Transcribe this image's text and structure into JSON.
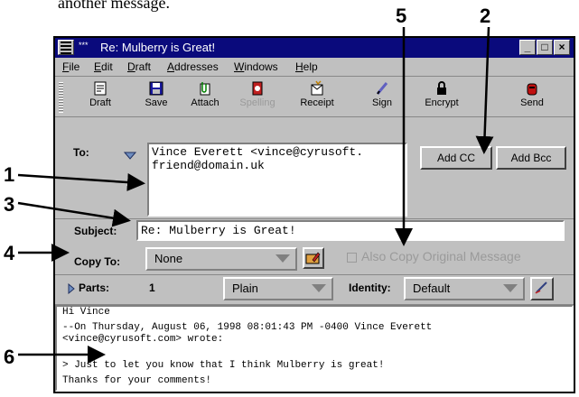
{
  "page": {
    "caption": "another message."
  },
  "window": {
    "title_prefix": "***",
    "title": "Re: Mulberry is Great!",
    "buttons": {
      "minimize": "_",
      "maximize": "□",
      "close": "×"
    }
  },
  "menubar": {
    "items": [
      {
        "label": "File",
        "ul": "F",
        "rest": "ile"
      },
      {
        "label": "Edit",
        "ul": "E",
        "rest": "dit"
      },
      {
        "label": "Draft",
        "ul": "D",
        "rest": "raft"
      },
      {
        "label": "Addresses",
        "ul": "A",
        "rest": "ddresses"
      },
      {
        "label": "Windows",
        "ul": "W",
        "rest": "indows"
      },
      {
        "label": "Help",
        "ul": "H",
        "rest": "elp"
      }
    ]
  },
  "toolbar": {
    "draft": "Draft",
    "save": "Save",
    "attach": "Attach",
    "spelling": "Spelling",
    "receipt": "Receipt",
    "sign": "Sign",
    "encrypt": "Encrypt",
    "send": "Send"
  },
  "header": {
    "to_label": "To:",
    "to_lines": [
      "Vince Everett <vince@cyrusoft.",
      "friend@domain.uk"
    ],
    "add_cc": "Add CC",
    "add_bcc": "Add Bcc",
    "subject_label": "Subject:",
    "subject_value": "Re: Mulberry is Great!",
    "copy_to_label": "Copy To:",
    "copy_to_value": "None",
    "also_copy_label": "Also Copy Original Message",
    "parts_label": "Parts:",
    "parts_count": "1",
    "format_value": "Plain",
    "identity_label": "Identity:",
    "identity_value": "Default"
  },
  "body": {
    "lines": [
      "Hi Vince",
      "--On Thursday, August 06, 1998 08:01:43 PM -0400 Vince Everett",
      "<vince@cyrusoft.com> wrote:",
      "",
      "> Just to let you know that I think Mulberry is great!",
      "Thanks for your comments!"
    ]
  },
  "callouts": {
    "c1": "1",
    "c2": "2",
    "c3": "3",
    "c4": "4",
    "c5": "5",
    "c6": "6"
  },
  "colors": {
    "titlebar": "#0a0a7c",
    "window_bg": "#c0c0c0",
    "disabled_text": "#9a9a9a"
  }
}
